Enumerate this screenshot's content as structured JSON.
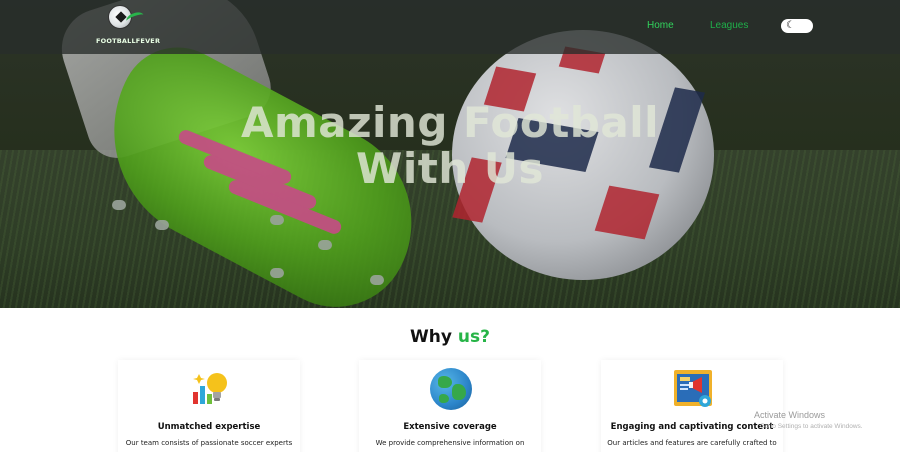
{
  "nav": {
    "logo_text": "FOOTBALLFEVER",
    "links": [
      {
        "label": "Home",
        "active": true
      },
      {
        "label": "Leagues",
        "active": false
      }
    ],
    "theme_toggle_icon": "moon-icon"
  },
  "hero": {
    "title_line1": "Amazing Football",
    "title_line2": "With Us"
  },
  "why": {
    "title_main": "Why",
    "title_accent": "us?",
    "cards": [
      {
        "icon": "lightbulb-chart-icon",
        "title": "Unmatched expertise",
        "text": "Our team consists of passionate soccer experts"
      },
      {
        "icon": "globe-icon",
        "title": "Extensive coverage",
        "text": "We provide comprehensive information on"
      },
      {
        "icon": "dashboard-megaphone-icon",
        "title": "Engaging and captivating content",
        "text": "Our articles and features are carefully crafted to"
      }
    ]
  },
  "watermark": {
    "title": "Activate Windows",
    "subtitle": "Go to Settings to activate Windows."
  },
  "colors": {
    "accent": "#27b447",
    "nav_link_active": "#32d35d",
    "nav_bg": "#282d2a"
  }
}
